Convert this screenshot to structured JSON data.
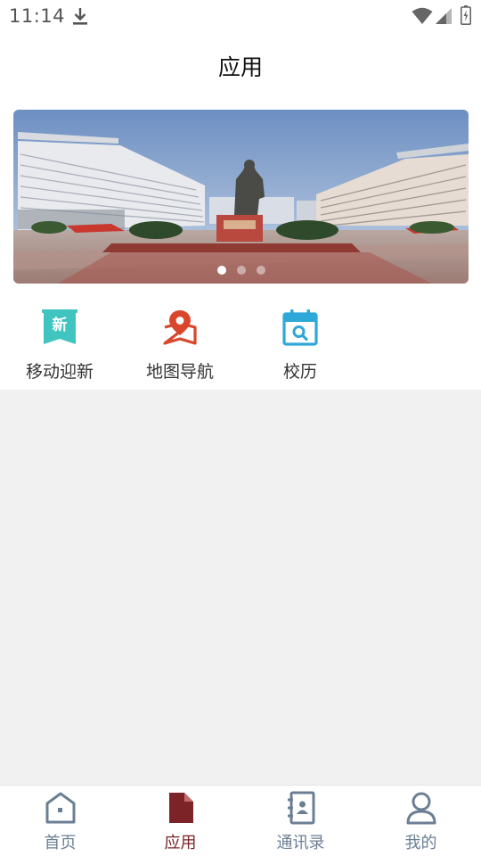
{
  "status_bar": {
    "time": "11:14",
    "icons": [
      "download-icon",
      "wifi-icon",
      "signal-icon",
      "battery-icon"
    ]
  },
  "header": {
    "title": "应用"
  },
  "banner": {
    "image": "campus-plaza-statue-photo",
    "page_count": 3,
    "active_page": 1
  },
  "apps": [
    {
      "label": "移动迎新",
      "icon": "new-student-badge-icon",
      "icon_text": "新",
      "color": "#3fc4c0"
    },
    {
      "label": "地图导航",
      "icon": "map-pin-icon",
      "color": "#d9462b"
    },
    {
      "label": "校历",
      "icon": "calendar-search-icon",
      "color": "#2da8d8"
    }
  ],
  "bottom_nav": {
    "active": "应用",
    "active_color": "#7b2326",
    "inactive_color": "#6b7f94",
    "items": [
      {
        "label": "首页",
        "icon": "home-icon"
      },
      {
        "label": "应用",
        "icon": "document-icon"
      },
      {
        "label": "通讯录",
        "icon": "contacts-book-icon"
      },
      {
        "label": "我的",
        "icon": "user-icon"
      }
    ]
  }
}
